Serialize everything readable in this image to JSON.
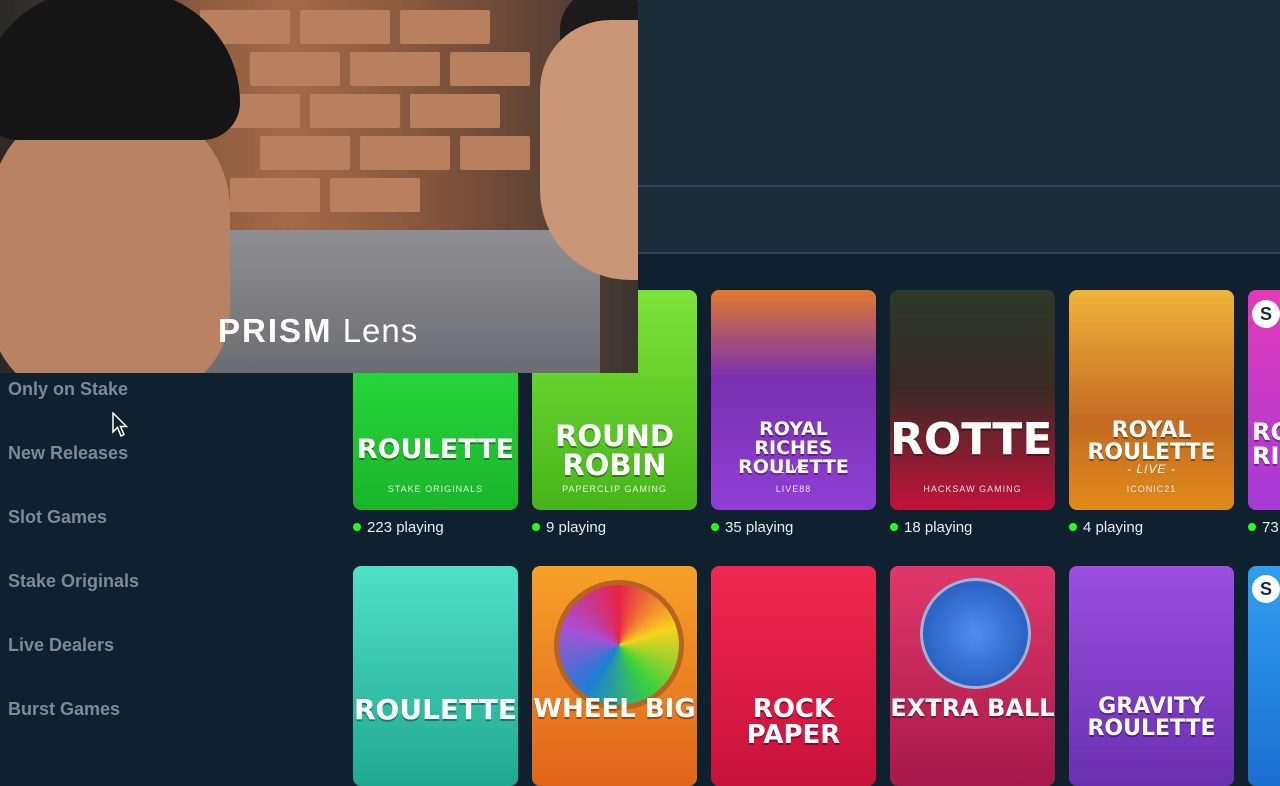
{
  "overlay": {
    "brand": "PRISM",
    "product": "Lens"
  },
  "sidebar": {
    "items": [
      {
        "label": "Only on Stake"
      },
      {
        "label": "New Releases"
      },
      {
        "label": "Slot Games"
      },
      {
        "label": "Stake Originals"
      },
      {
        "label": "Live Dealers"
      },
      {
        "label": "Burst Games"
      }
    ]
  },
  "games_row1": [
    {
      "title": "ROULETTE",
      "subtitle": "",
      "provider": "STAKE ORIGINALS",
      "playing": "223 playing",
      "color": "#2bd93b"
    },
    {
      "title": "ROUND ROBIN",
      "subtitle": "",
      "provider": "PAPERCLIP GAMING",
      "playing": "9 playing",
      "color": "#6ecf2a"
    },
    {
      "title": "ROYAL RICHES ROULETTE",
      "subtitle": "- LIVE -",
      "provider": "LIVE88",
      "playing": "35 playing",
      "color": "#8b3bd1"
    },
    {
      "title": "ROTTEN",
      "subtitle": "",
      "provider": "HACKSAW GAMING",
      "playing": "18 playing",
      "color": "#c3123a"
    },
    {
      "title": "ROYAL ROULETTE",
      "subtitle": "- LIVE -",
      "provider": "ICONIC21",
      "playing": "4 playing",
      "color": "#e08a1a"
    },
    {
      "title": "RO RI",
      "subtitle": "",
      "provider": "",
      "playing": "73",
      "color": "#c83aa8"
    }
  ],
  "games_row2": [
    {
      "title": "ROULETTE",
      "color": "#2ec9b0"
    },
    {
      "title": "WHEEL BIG",
      "color": "#f08a1e"
    },
    {
      "title": "ROCK PAPER",
      "color": "#e8234a"
    },
    {
      "title": "EXTRA BALL",
      "color": "#d0265e"
    },
    {
      "title": "GRAVITY ROULETTE",
      "color": "#a84fd6"
    },
    {
      "title": "",
      "color": "#1e7fd6"
    }
  ],
  "badges": {
    "stake_logo": "S"
  }
}
